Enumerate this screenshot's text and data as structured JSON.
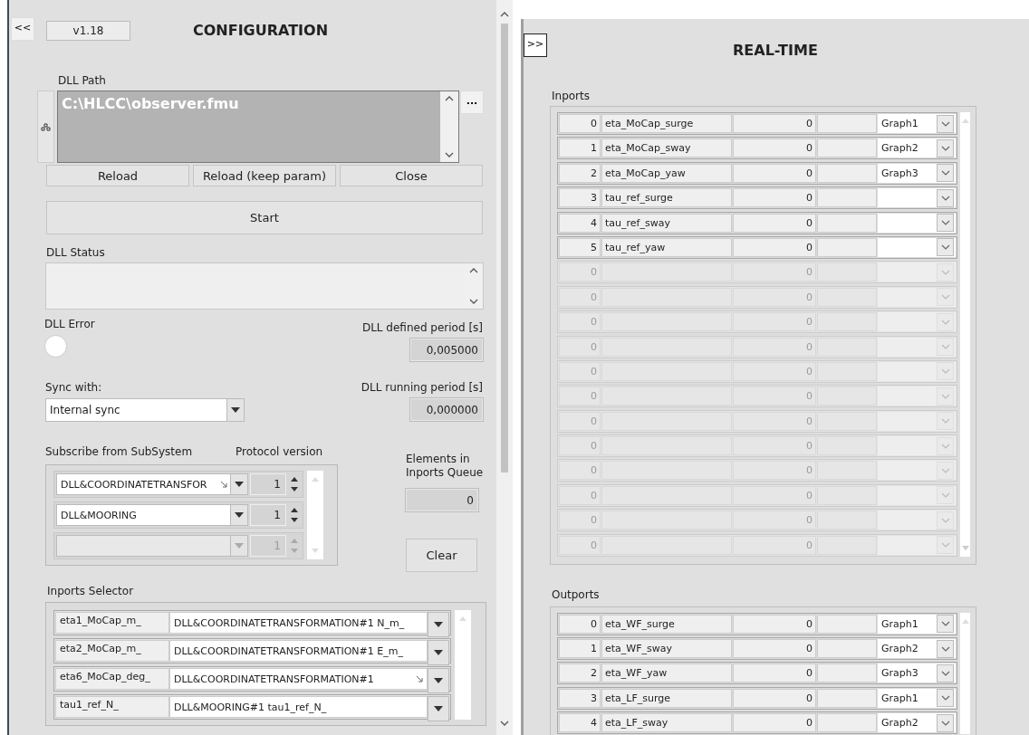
{
  "config": {
    "collapse_button": "<<",
    "version": "v1.18",
    "title": "CONFIGURATION",
    "dll_path": {
      "label": "DLL Path",
      "value": "C:\\HLCC\\observer.fmu",
      "browse_button": "..."
    },
    "path_buttons": [
      "Reload",
      "Reload (keep param)",
      "Close"
    ],
    "start_button": "Start",
    "dll_status": {
      "label": "DLL Status"
    },
    "dll_error": {
      "label": "DLL Error",
      "on": false
    },
    "defined_period": {
      "label": "DLL defined period [s]",
      "value": "0,005000"
    },
    "sync": {
      "label": "Sync with:",
      "value": "Internal sync"
    },
    "running_period": {
      "label": "DLL running period [s]",
      "value": "0,000000"
    },
    "subscribe": {
      "label": "Subscribe from SubSystem",
      "protocol_label": "Protocol version",
      "rows": [
        {
          "subsystem": "DLL&COORDINATETRANSFOR",
          "truncated": true,
          "version": "1",
          "disabled": false
        },
        {
          "subsystem": "DLL&MOORING",
          "truncated": false,
          "version": "1",
          "disabled": false
        },
        {
          "version": "1",
          "disabled": true,
          "truncated": false
        }
      ]
    },
    "queue": {
      "label": "Elements in Inports Queue",
      "value": "0"
    },
    "clear_button": "Clear",
    "inports_selector": {
      "label": "Inports Selector",
      "rows": [
        {
          "name": "eta1_MoCap_m_",
          "source": "DLL&COORDINATETRANSFORMATION#1 N_m_",
          "truncated": false
        },
        {
          "name": "eta2_MoCap_m_",
          "source": "DLL&COORDINATETRANSFORMATION#1 E_m_",
          "truncated": false
        },
        {
          "name": "eta6_MoCap_deg_",
          "source": "DLL&COORDINATETRANSFORMATION#1",
          "truncated": true
        },
        {
          "name": "tau1_ref_N_",
          "source": "DLL&MOORING#1 tau1_ref_N_",
          "truncated": false
        }
      ]
    }
  },
  "realtime": {
    "expand_button": ">>",
    "title": "REAL-TIME",
    "inports": {
      "label": "Inports",
      "rows": [
        {
          "index": "0",
          "name": "eta_MoCap_surge",
          "value": "0",
          "graph": "Graph1",
          "disabled": false
        },
        {
          "index": "1",
          "name": "eta_MoCap_sway",
          "value": "0",
          "graph": "Graph2",
          "disabled": false
        },
        {
          "index": "2",
          "name": "eta_MoCap_yaw",
          "value": "0",
          "graph": "Graph3",
          "disabled": false
        },
        {
          "index": "3",
          "name": "tau_ref_surge",
          "value": "0",
          "disabled": false
        },
        {
          "index": "4",
          "name": "tau_ref_sway",
          "value": "0",
          "disabled": false
        },
        {
          "index": "5",
          "name": "tau_ref_yaw",
          "value": "0",
          "disabled": false
        },
        {
          "index": "0",
          "value": "0",
          "disabled": true
        },
        {
          "index": "0",
          "value": "0",
          "disabled": true
        },
        {
          "index": "0",
          "value": "0",
          "disabled": true
        },
        {
          "index": "0",
          "value": "0",
          "disabled": true
        },
        {
          "index": "0",
          "value": "0",
          "disabled": true
        },
        {
          "index": "0",
          "value": "0",
          "disabled": true
        },
        {
          "index": "0",
          "value": "0",
          "disabled": true
        },
        {
          "index": "0",
          "value": "0",
          "disabled": true
        },
        {
          "index": "0",
          "value": "0",
          "disabled": true
        },
        {
          "index": "0",
          "value": "0",
          "disabled": true
        },
        {
          "index": "0",
          "value": "0",
          "disabled": true
        },
        {
          "index": "0",
          "value": "0",
          "disabled": true
        }
      ]
    },
    "outports": {
      "label": "Outports",
      "rows": [
        {
          "index": "0",
          "name": "eta_WF_surge",
          "value": "0",
          "graph": "Graph1",
          "disabled": false
        },
        {
          "index": "1",
          "name": "eta_WF_sway",
          "value": "0",
          "graph": "Graph2",
          "disabled": false
        },
        {
          "index": "2",
          "name": "eta_WF_yaw",
          "value": "0",
          "graph": "Graph3",
          "disabled": false
        },
        {
          "index": "3",
          "name": "eta_LF_surge",
          "value": "0",
          "graph": "Graph1",
          "disabled": false
        },
        {
          "index": "4",
          "name": "eta_LF_sway",
          "value": "0",
          "graph": "Graph2",
          "disabled": false
        }
      ]
    }
  }
}
